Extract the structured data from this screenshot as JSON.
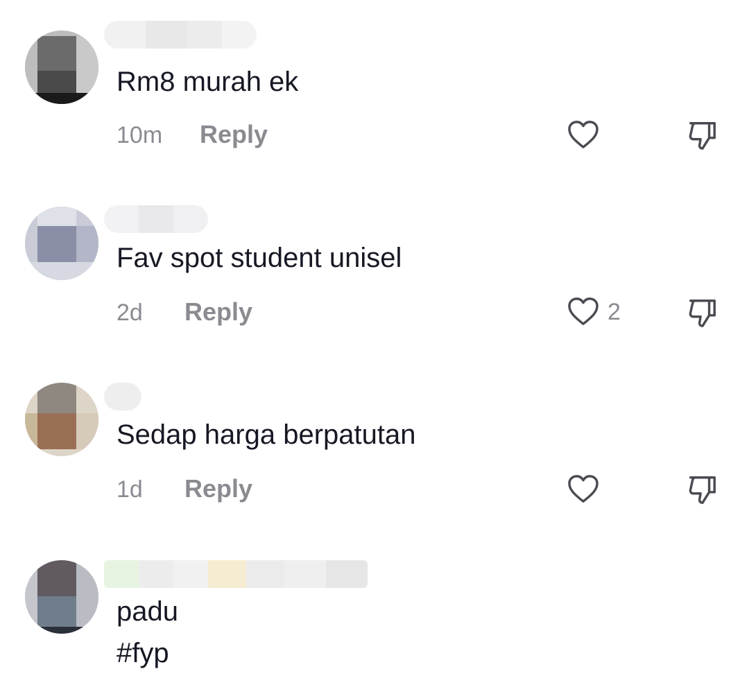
{
  "comments": [
    {
      "text": "Rm8 murah ek",
      "time": "10m",
      "reply_label": "Reply",
      "likes": ""
    },
    {
      "text": "Fav spot student unisel",
      "time": "2d",
      "reply_label": "Reply",
      "likes": "2"
    },
    {
      "text": "Sedap harga berpatutan",
      "time": "1d",
      "reply_label": "Reply",
      "likes": ""
    },
    {
      "text_line1": "padu",
      "text_line2": "#fyp"
    }
  ],
  "icons": {
    "like": "heart-outline-icon",
    "dislike": "thumbs-down-outline-icon"
  },
  "colors": {
    "text": "#161823",
    "secondary": "#8a8b91"
  }
}
